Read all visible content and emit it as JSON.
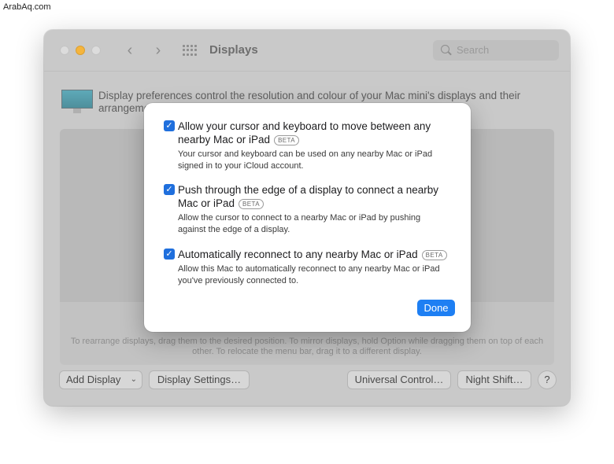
{
  "watermark": "ArabAq.com",
  "window": {
    "title": "Displays",
    "search_placeholder": "Search",
    "description": "Display preferences control the resolution and colour of your Mac mini's displays and their arrangement.",
    "arrangement_hint": "To rearrange displays, drag them to the desired position. To mirror displays, hold Option while dragging them on top of each other. To relocate the menu bar, drag it to a different display.",
    "nav": {
      "back_icon": "‹",
      "forward_icon": "›"
    }
  },
  "toolbar": {
    "add_display": "Add Display",
    "add_display_chevron": "⌄",
    "display_settings": "Display Settings…",
    "universal_control": "Universal Control…",
    "night_shift": "Night Shift…",
    "help": "?"
  },
  "sheet": {
    "options": [
      {
        "checked": true,
        "title": "Allow your cursor and keyboard to move between any nearby Mac or iPad",
        "badge": "BETA",
        "description": "Your cursor and keyboard can be used on any nearby Mac or iPad signed in to your iCloud account."
      },
      {
        "checked": true,
        "title": "Push through the edge of a display to connect a nearby Mac or iPad",
        "badge": "BETA",
        "description": "Allow the cursor to connect to a nearby Mac or iPad by pushing against the edge of a display."
      },
      {
        "checked": true,
        "title": "Automatically reconnect to any nearby Mac or iPad",
        "badge": "BETA",
        "description": "Allow this Mac to automatically reconnect to any nearby Mac or iPad you've previously connected to."
      }
    ],
    "checkmark": "✓",
    "done_label": "Done"
  },
  "colors": {
    "accent": "#1e7ff3",
    "checkbox": "#1f6fdd",
    "minimize": "#f5b53d"
  }
}
